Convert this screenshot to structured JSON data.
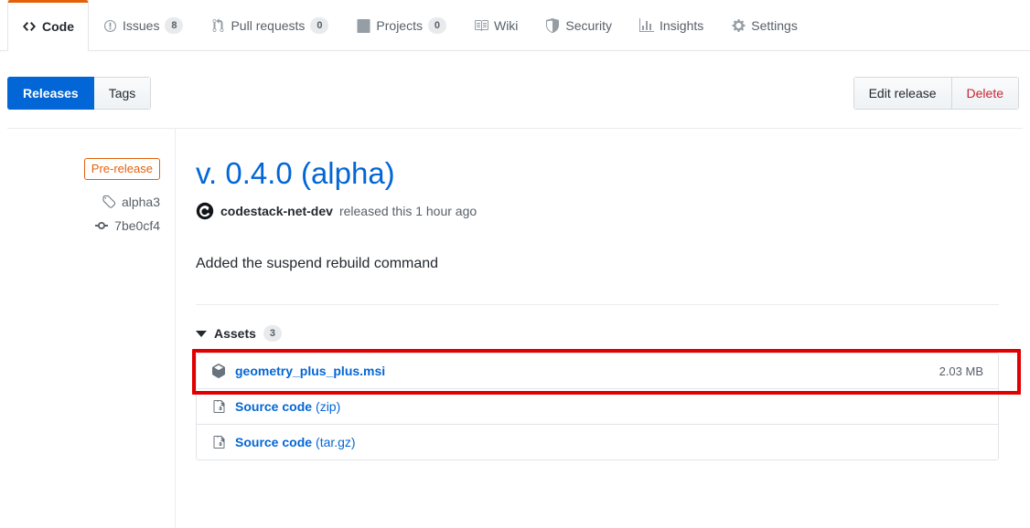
{
  "repo_nav": {
    "items": [
      {
        "label": "Code",
        "icon": "code-icon",
        "count": null,
        "selected": true
      },
      {
        "label": "Issues",
        "icon": "issue-opened-icon",
        "count": "8",
        "selected": false
      },
      {
        "label": "Pull requests",
        "icon": "git-pull-request-icon",
        "count": "0",
        "selected": false
      },
      {
        "label": "Projects",
        "icon": "project-icon",
        "count": "0",
        "selected": false
      },
      {
        "label": "Wiki",
        "icon": "book-icon",
        "count": null,
        "selected": false
      },
      {
        "label": "Security",
        "icon": "shield-icon",
        "count": null,
        "selected": false
      },
      {
        "label": "Insights",
        "icon": "graph-icon",
        "count": null,
        "selected": false
      },
      {
        "label": "Settings",
        "icon": "gear-icon",
        "count": null,
        "selected": false
      }
    ]
  },
  "subhead": {
    "releases_label": "Releases",
    "tags_label": "Tags",
    "edit_release_label": "Edit release",
    "delete_label": "Delete"
  },
  "release": {
    "prerelease_label": "Pre-release",
    "tag_name": "alpha3",
    "commit_sha": "7be0cf4",
    "title": "v. 0.4.0 (alpha)",
    "author": "codestack-net-dev",
    "byline_suffix": "released this 1 hour ago",
    "description": "Added the suspend rebuild command",
    "assets_label": "Assets",
    "assets_count": "3",
    "assets": [
      {
        "name": "geometry_plus_plus.msi",
        "ext": "",
        "size": "2.03 MB",
        "icon": "package-icon",
        "highlighted": true
      },
      {
        "name": "Source code",
        "ext": "(zip)",
        "size": "",
        "icon": "file-zip-icon",
        "highlighted": false
      },
      {
        "name": "Source code",
        "ext": "(tar.gz)",
        "size": "",
        "icon": "file-zip-icon",
        "highlighted": false
      }
    ]
  },
  "colors": {
    "accent_blue": "#0366d6",
    "orange": "#e36209",
    "danger_red": "#cb2431",
    "highlight_red": "#e00000",
    "border": "#e1e4e8",
    "muted_text": "#586069"
  }
}
